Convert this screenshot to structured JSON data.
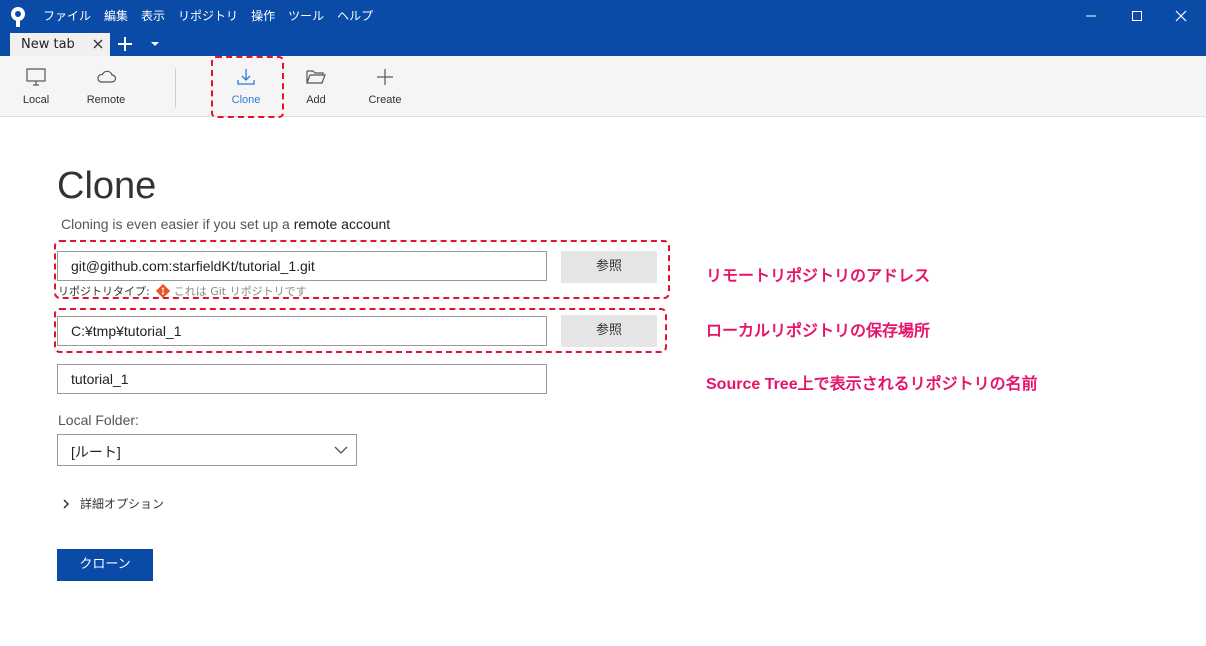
{
  "menu": [
    "ファイル",
    "編集",
    "表示",
    "リポジトリ",
    "操作",
    "ツール",
    "ヘルプ"
  ],
  "tab": {
    "label": "New tab"
  },
  "toolbar": {
    "local": "Local",
    "remote": "Remote",
    "clone": "Clone",
    "add": "Add",
    "create": "Create"
  },
  "page": {
    "title": "Clone",
    "subtitle_prefix": "Cloning is even easier if you set up a ",
    "subtitle_link": "remote account"
  },
  "form": {
    "source_url": "git@github.com:starfieldKt/tutorial_1.git",
    "browse_label": "参照",
    "repo_type_label": "リポジトリタイプ:",
    "repo_type_value": "これは Git リポジトリです",
    "dest_path": "C:¥tmp¥tutorial_1",
    "name": "tutorial_1",
    "local_folder_label": "Local Folder:",
    "local_folder_value": "[ルート]",
    "advanced_label": "詳細オプション",
    "clone_button": "クローン"
  },
  "annotations": {
    "remote_address": "リモートリポジトリのアドレス",
    "local_location": "ローカルリポジトリの保存場所",
    "display_name": "Source Tree上で表示されるリポジトリの名前"
  },
  "colors": {
    "brand": "#0a4ba8",
    "annotation": "#e6136b",
    "highlight_border": "#e8112d",
    "clone_active": "#2b7cd3"
  }
}
